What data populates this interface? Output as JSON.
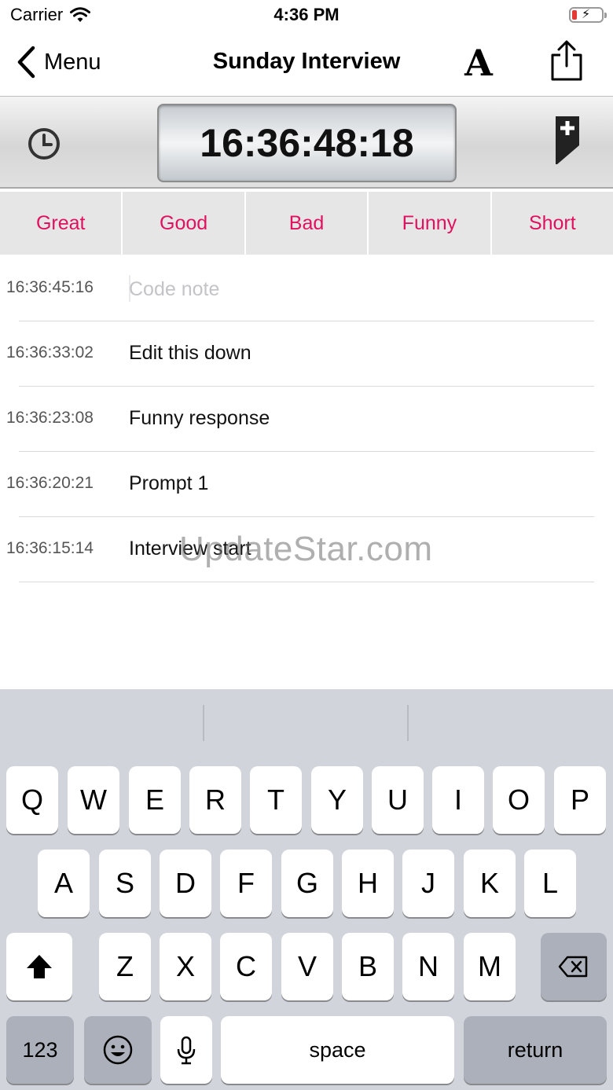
{
  "status_bar": {
    "carrier": "Carrier",
    "time": "4:36 PM"
  },
  "nav": {
    "back_label": "Menu",
    "title": "Sunday Interview",
    "font_button": "A"
  },
  "timecode": {
    "display": "16:36:48:18"
  },
  "quick_codes": [
    "Great",
    "Good",
    "Bad",
    "Funny",
    "Short"
  ],
  "notes": [
    {
      "time": "16:36:45:16",
      "text": "",
      "placeholder": "Code note"
    },
    {
      "time": "16:36:33:02",
      "text": "Edit this down"
    },
    {
      "time": "16:36:23:08",
      "text": "Funny response"
    },
    {
      "time": "16:36:20:21",
      "text": "Prompt 1"
    },
    {
      "time": "16:36:15:14",
      "text": "Interview start"
    }
  ],
  "watermark": "UpdateStar.com",
  "keyboard": {
    "row1": [
      "Q",
      "W",
      "E",
      "R",
      "T",
      "Y",
      "U",
      "I",
      "O",
      "P"
    ],
    "row2": [
      "A",
      "S",
      "D",
      "F",
      "G",
      "H",
      "J",
      "K",
      "L"
    ],
    "row3": [
      "Z",
      "X",
      "C",
      "V",
      "B",
      "N",
      "M"
    ],
    "numbers_key": "123",
    "space_key": "space",
    "return_key": "return"
  },
  "icons": {
    "back": "chevron-left-icon",
    "share": "share-icon",
    "clock": "clock-icon",
    "marker": "marker-plus-icon",
    "wifi": "wifi-icon",
    "battery": "battery-charging-icon",
    "shift": "shift-icon",
    "delete": "backspace-icon",
    "emoji": "emoji-icon",
    "mic": "microphone-icon"
  },
  "colors": {
    "accent": "#e0115f",
    "keyboard_bg": "#d1d4da",
    "battery_low": "#e53935"
  }
}
